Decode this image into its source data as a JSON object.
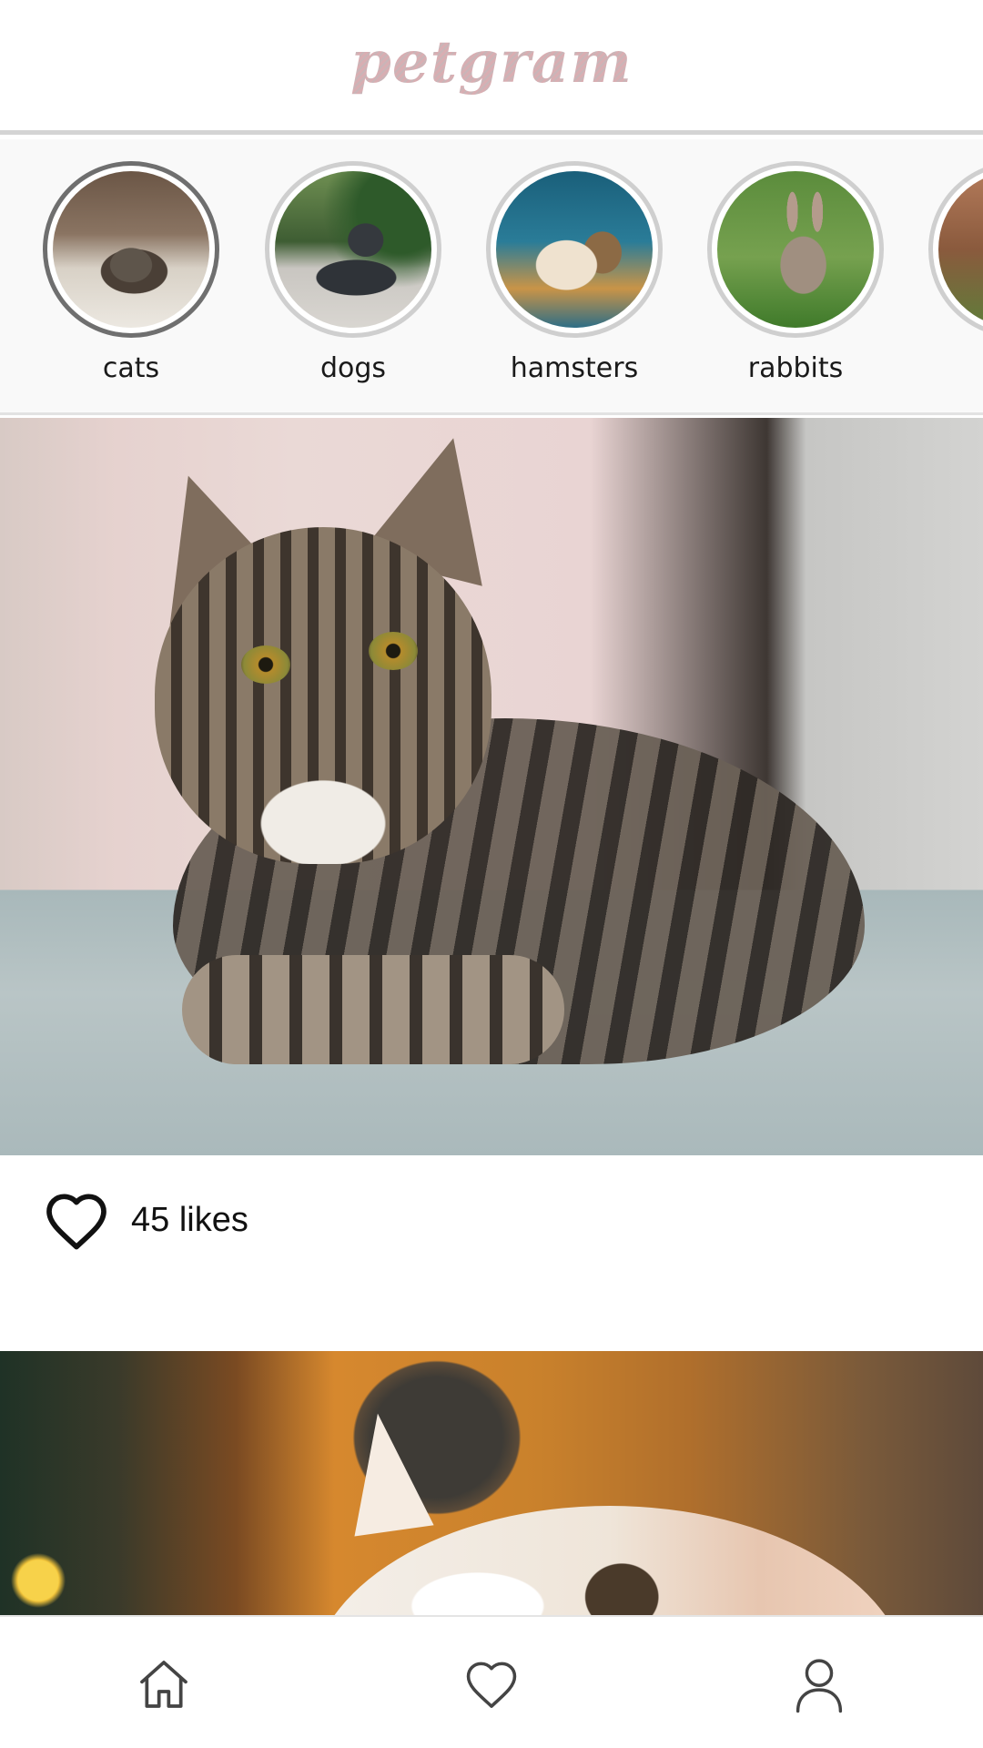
{
  "app": {
    "logo": "petgram"
  },
  "stories": [
    {
      "label": "cats",
      "active": true,
      "icon": "cat-thumbnail"
    },
    {
      "label": "dogs",
      "active": false,
      "icon": "dog-thumbnail"
    },
    {
      "label": "hamsters",
      "active": false,
      "icon": "hamster-thumbnail"
    },
    {
      "label": "rabbits",
      "active": false,
      "icon": "rabbit-thumbnail"
    },
    {
      "label": "",
      "active": false,
      "icon": "partial-thumbnail"
    }
  ],
  "feed": {
    "post1": {
      "likes": "45 likes",
      "like_icon": "heart-outline-icon"
    }
  },
  "bottom_nav": {
    "items": [
      {
        "name": "home",
        "icon": "home-icon"
      },
      {
        "name": "likes",
        "icon": "heart-icon"
      },
      {
        "name": "profile",
        "icon": "user-icon"
      }
    ]
  },
  "colors": {
    "logo": "#d3a9ad",
    "active_ring": "#6f6f6f",
    "inactive_ring": "#cfcfcf",
    "icon_stroke": "#444444"
  }
}
